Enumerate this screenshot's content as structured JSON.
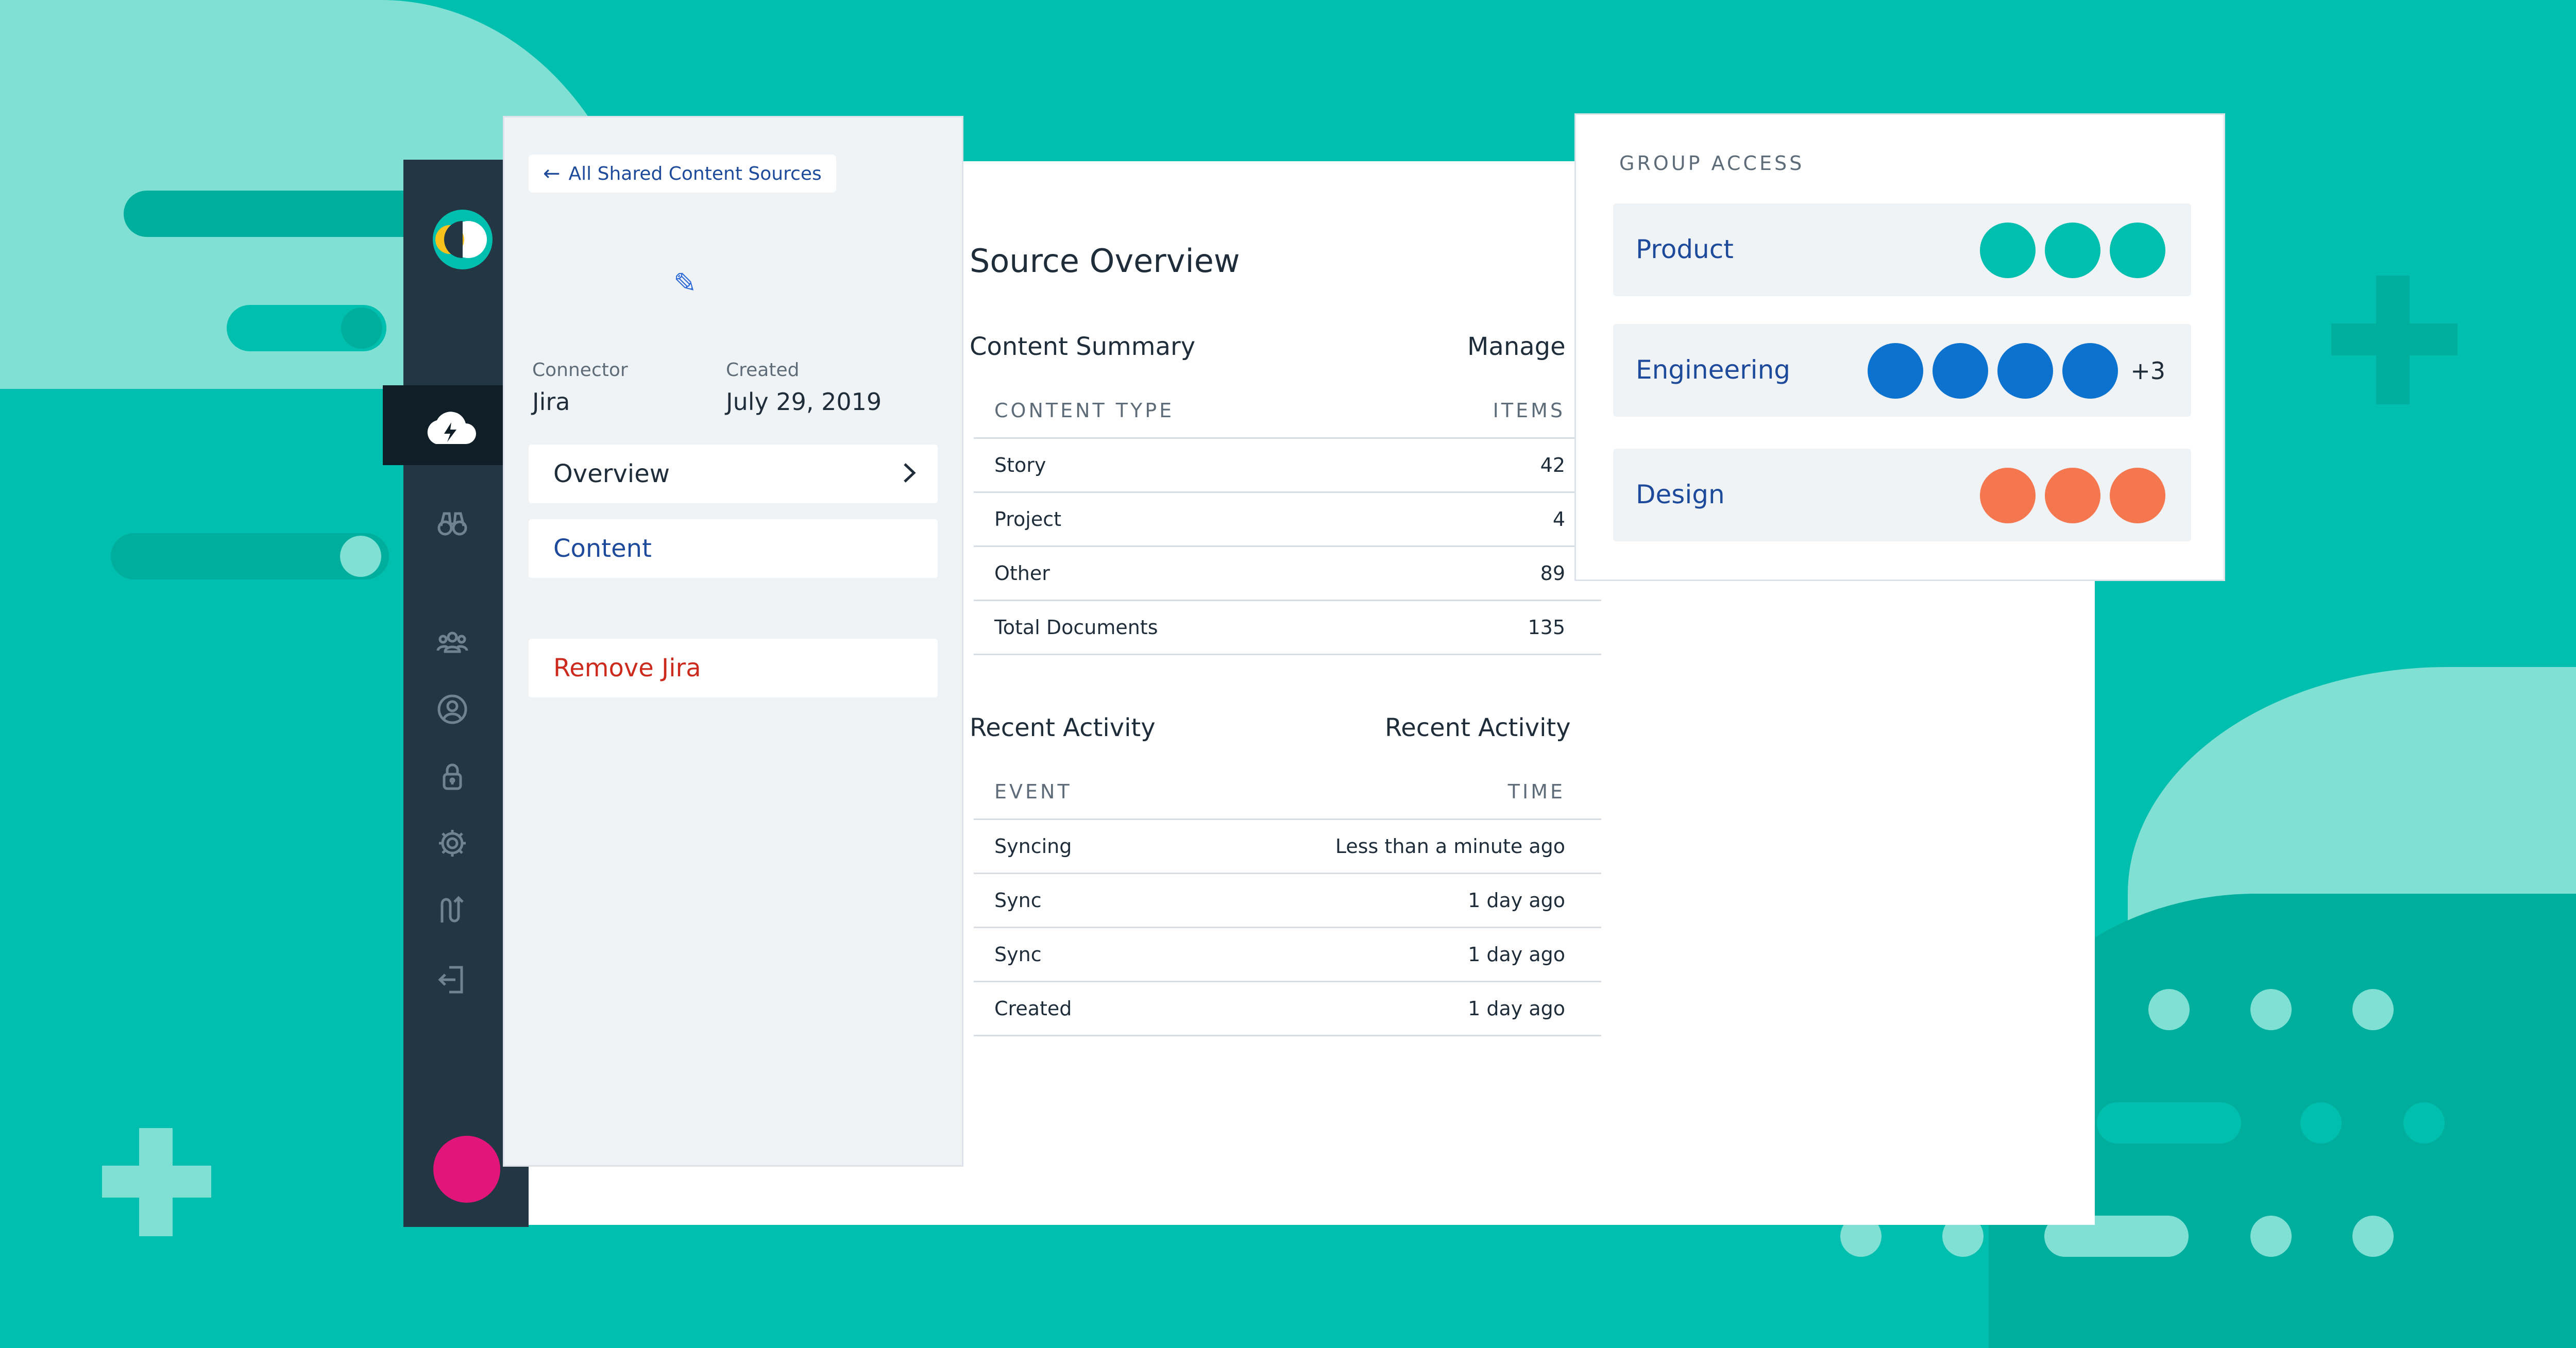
{
  "back_link": {
    "label": "All Shared Content Sources"
  },
  "meta": {
    "connector_label": "Connector",
    "connector_value": "Jira",
    "created_label": "Created",
    "created_value": "July 29, 2019"
  },
  "menu": {
    "overview": "Overview",
    "content": "Content",
    "remove": "Remove Jira"
  },
  "main": {
    "title": "Source Overview",
    "content_summary": {
      "heading": "Content Summary",
      "action": "Manage",
      "col_type": "CONTENT TYPE",
      "col_items": "ITEMS",
      "rows": [
        {
          "type": "Story",
          "items": "42"
        },
        {
          "type": "Project",
          "items": "4"
        },
        {
          "type": "Other",
          "items": "89"
        },
        {
          "type": "Total Documents",
          "items": "135"
        }
      ]
    },
    "recent_activity": {
      "heading": "Recent Activity",
      "action": "Recent Activity",
      "col_event": "EVENT",
      "col_time": "TIME",
      "rows": [
        {
          "event": "Syncing",
          "time": "Less than a minute ago"
        },
        {
          "event": "Sync",
          "time": "1 day ago"
        },
        {
          "event": "Sync",
          "time": "1 day ago"
        },
        {
          "event": "Created",
          "time": "1 day ago"
        }
      ]
    }
  },
  "group_access": {
    "title": "GROUP ACCESS",
    "groups": [
      {
        "name": "Product",
        "members": 3,
        "more": "",
        "color": "#00bfae"
      },
      {
        "name": "Engineering",
        "members": 4,
        "more": "+3",
        "color": "#0b72d0"
      },
      {
        "name": "Design",
        "members": 3,
        "more": "",
        "color": "#f5774f"
      }
    ]
  },
  "sidebar": {
    "icons": [
      "binoculars-icon",
      "cloud-bolt-icon",
      "users-icon",
      "user-circle-icon",
      "lock-icon",
      "gear-icon",
      "sync-arrows-icon",
      "logout-icon"
    ]
  },
  "colors": {
    "background": "#00bfae",
    "sidebar": "#233643",
    "accent_blue": "#1d4a9a",
    "danger": "#cc2a1d",
    "avatar": "#e2157a"
  }
}
